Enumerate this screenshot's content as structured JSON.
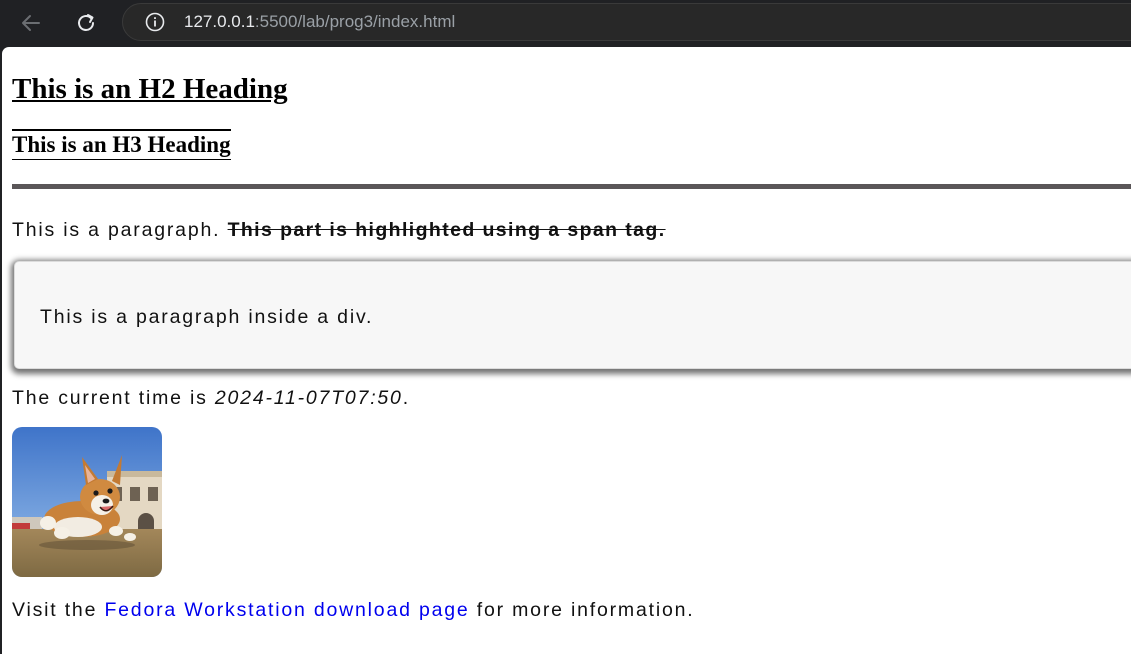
{
  "browser": {
    "url_host": "127.0.0.1",
    "url_path": ":5500/lab/prog3/index.html",
    "back_icon": "arrow-left-icon",
    "reload_icon": "reload-icon",
    "info_icon": "info-icon"
  },
  "page": {
    "h2": "This is an H2 Heading",
    "h3": "This is an H3 Heading",
    "paragraph_text": "This is a paragraph. ",
    "span_text": "This part is highlighted using a span tag.",
    "div_paragraph": "This is a paragraph inside a div.",
    "time_prefix": "The current time is ",
    "time_value": "2024-11-07T07:50",
    "time_suffix": ".",
    "link_prefix": "Visit the ",
    "link_text": "Fedora Workstation download page",
    "link_suffix": " for more information.",
    "image_subject": "corgi-photo"
  },
  "colors": {
    "link": "#0000ee",
    "rule": "#5a5658",
    "browser_chrome": "#202124"
  }
}
